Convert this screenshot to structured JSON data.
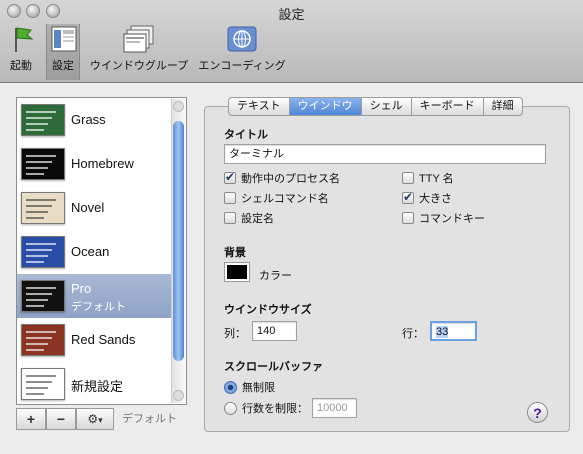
{
  "window": {
    "title": "設定"
  },
  "toolbar": [
    {
      "label": "起動",
      "icon": "startup-flag-icon"
    },
    {
      "label": "設定",
      "icon": "settings-window-icon",
      "selected": true
    },
    {
      "label": "ウインドウグループ",
      "icon": "window-group-icon"
    },
    {
      "label": "エンコーディング",
      "icon": "encoding-globe-icon"
    }
  ],
  "profiles": [
    {
      "name": "Grass",
      "thumb": "#2e6b3b"
    },
    {
      "name": "Homebrew",
      "thumb": "#0a0a0a"
    },
    {
      "name": "Novel",
      "thumb": "#e8dcc4"
    },
    {
      "name": "Ocean",
      "thumb": "#2a4ea8"
    },
    {
      "name": "Pro",
      "sub": "デフォルト",
      "thumb": "#111111",
      "selected": true
    },
    {
      "name": "Red Sands",
      "thumb": "#8b3424"
    },
    {
      "name": "新規設定",
      "thumb": "#ffffff"
    }
  ],
  "bottom_bar": {
    "add": "+",
    "remove": "−",
    "gear": "⚙",
    "chevron": "▾",
    "default_label": "デフォルト"
  },
  "tabs": [
    {
      "label": "テキスト"
    },
    {
      "label": "ウインドウ",
      "active": true
    },
    {
      "label": "シェル"
    },
    {
      "label": "キーボード"
    },
    {
      "label": "詳細"
    }
  ],
  "title_section": {
    "heading": "タイトル",
    "value": "ターミナル",
    "options": [
      {
        "label": "動作中のプロセス名",
        "checked": true
      },
      {
        "label": "シェルコマンド名",
        "checked": false
      },
      {
        "label": "設定名",
        "checked": false
      },
      {
        "label": "TTY 名",
        "checked": false
      },
      {
        "label": "大きさ",
        "checked": true
      },
      {
        "label": "コマンドキー",
        "checked": false
      }
    ]
  },
  "background": {
    "heading": "背景",
    "color_label": "カラー",
    "color": "#000000"
  },
  "window_size": {
    "heading": "ウインドウサイズ",
    "cols_label": "列：",
    "cols": "140",
    "rows_label": "行：",
    "rows": "33"
  },
  "scrollback": {
    "heading": "スクロールバッファ",
    "unlimited": "無制限",
    "limit_label": "行数を制限：",
    "limit_value": "10000",
    "selected": "unlimited"
  },
  "help": "?",
  "accent": "#4f86d8"
}
